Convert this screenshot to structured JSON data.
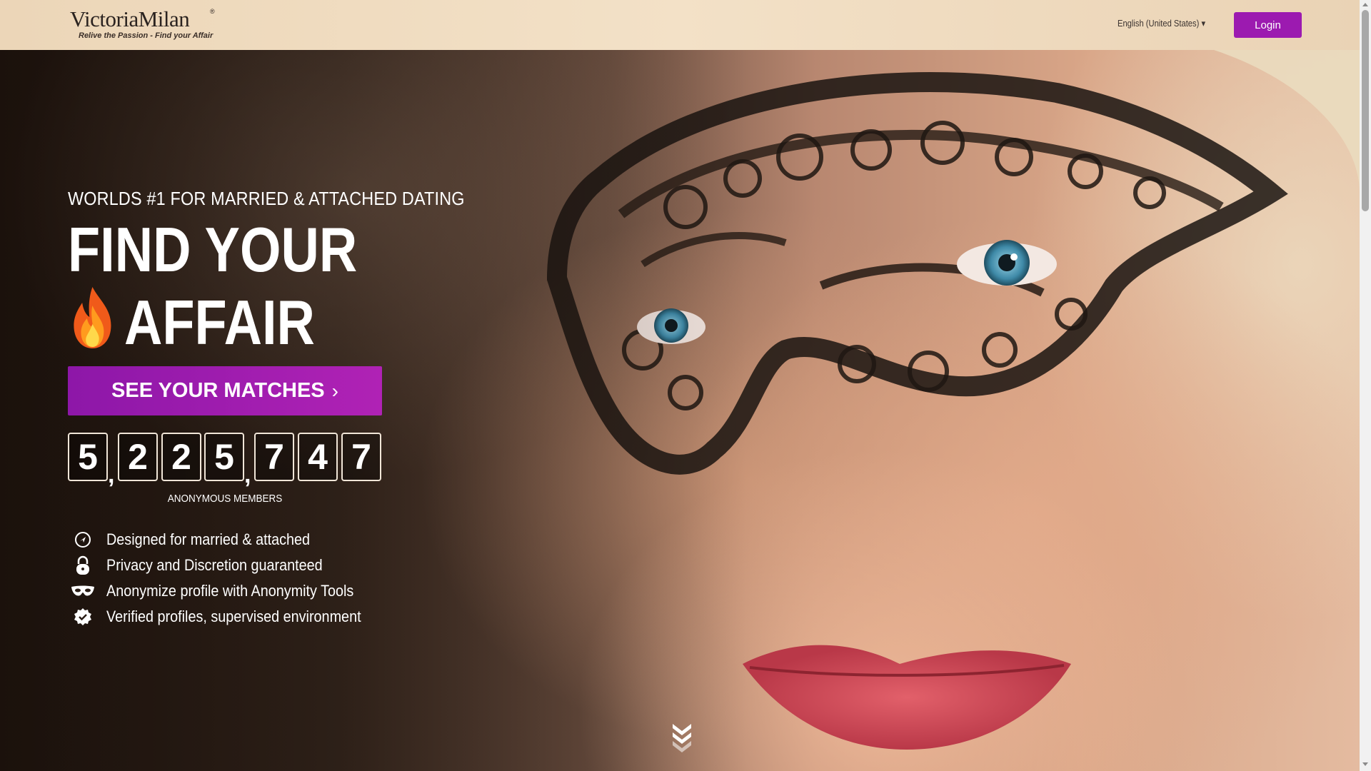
{
  "header": {
    "logo_text": "VictoriaMilan",
    "logo_reg": "®",
    "logo_tagline": "Relive the Passion - Find your Affair",
    "language": "English (United States) ▾",
    "login_label": "Login"
  },
  "hero": {
    "subheading": "WORLDS #1 FOR MARRIED & ATTACHED DATING",
    "headline_line1": "FIND YOUR",
    "headline_line2": "AFFAIR",
    "flame_icon": "fire-icon",
    "cta_label": "SEE YOUR MATCHES",
    "cta_chevron": "›",
    "counter_digits": [
      "5",
      "2",
      "2",
      "5",
      "7",
      "4",
      "7"
    ],
    "counter_separator": ",",
    "counter_label": "ANONYMOUS MEMBERS",
    "features": [
      {
        "icon": "location-pin-icon",
        "text": "Designed for married & attached"
      },
      {
        "icon": "lock-icon",
        "text": "Privacy and Discretion guaranteed"
      },
      {
        "icon": "masquerade-mask-icon",
        "text": "Anonymize profile with Anonymity Tools"
      },
      {
        "icon": "verified-check-icon",
        "text": "Verified profiles, supervised environment"
      }
    ],
    "scroll_icon": "double-chevron-down-icon"
  },
  "colors": {
    "accent": "#9c1ab0",
    "cta_gradient_start": "#8d17a8",
    "cta_gradient_end": "#b022b5",
    "header_bg": "#f0dcc0"
  }
}
